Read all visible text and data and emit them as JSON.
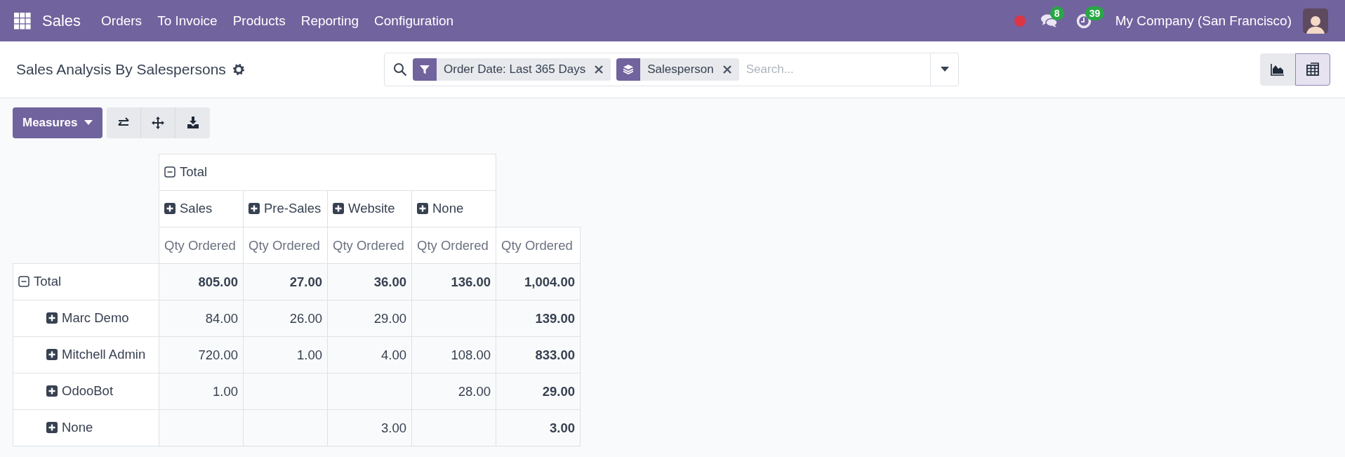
{
  "navbar": {
    "app": "Sales",
    "menu": [
      "Orders",
      "To Invoice",
      "Products",
      "Reporting",
      "Configuration"
    ],
    "messages_count": "8",
    "activities_count": "39",
    "company": "My Company (San Francisco)"
  },
  "control_panel": {
    "title": "Sales Analysis By Salespersons",
    "facets": [
      {
        "kind": "filter",
        "label": "Order Date: Last 365 Days"
      },
      {
        "kind": "group",
        "label": "Salesperson"
      }
    ],
    "search": {
      "placeholder": "Search..."
    },
    "views": [
      {
        "kind": "graph",
        "selected": false
      },
      {
        "kind": "pivot",
        "selected": true
      }
    ]
  },
  "toolbar": {
    "measures": "Measures"
  },
  "pivot": {
    "column_group": {
      "label": "Total",
      "expanded": true
    },
    "columns": [
      {
        "label": "Sales",
        "expanded": false
      },
      {
        "label": "Pre-Sales",
        "expanded": false
      },
      {
        "label": "Website",
        "expanded": false
      },
      {
        "label": "None",
        "expanded": false
      }
    ],
    "measures": [
      "Qty Ordered",
      "Qty Ordered",
      "Qty Ordered",
      "Qty Ordered",
      "Qty Ordered"
    ],
    "rows": [
      {
        "label": "Total",
        "expanded": true,
        "cells": [
          "805.00",
          "27.00",
          "36.00",
          "136.00",
          "1,004.00"
        ],
        "children": [
          {
            "label": "Marc Demo",
            "expanded": false,
            "cells": [
              "84.00",
              "26.00",
              "29.00",
              null,
              "139.00"
            ]
          },
          {
            "label": "Mitchell Admin",
            "expanded": false,
            "cells": [
              "720.00",
              "1.00",
              "4.00",
              "108.00",
              "833.00"
            ]
          },
          {
            "label": "OdooBot",
            "expanded": false,
            "cells": [
              "1.00",
              null,
              null,
              "28.00",
              "29.00"
            ]
          },
          {
            "label": "None",
            "expanded": false,
            "cells": [
              null,
              null,
              "3.00",
              null,
              "3.00"
            ]
          }
        ]
      }
    ]
  }
}
